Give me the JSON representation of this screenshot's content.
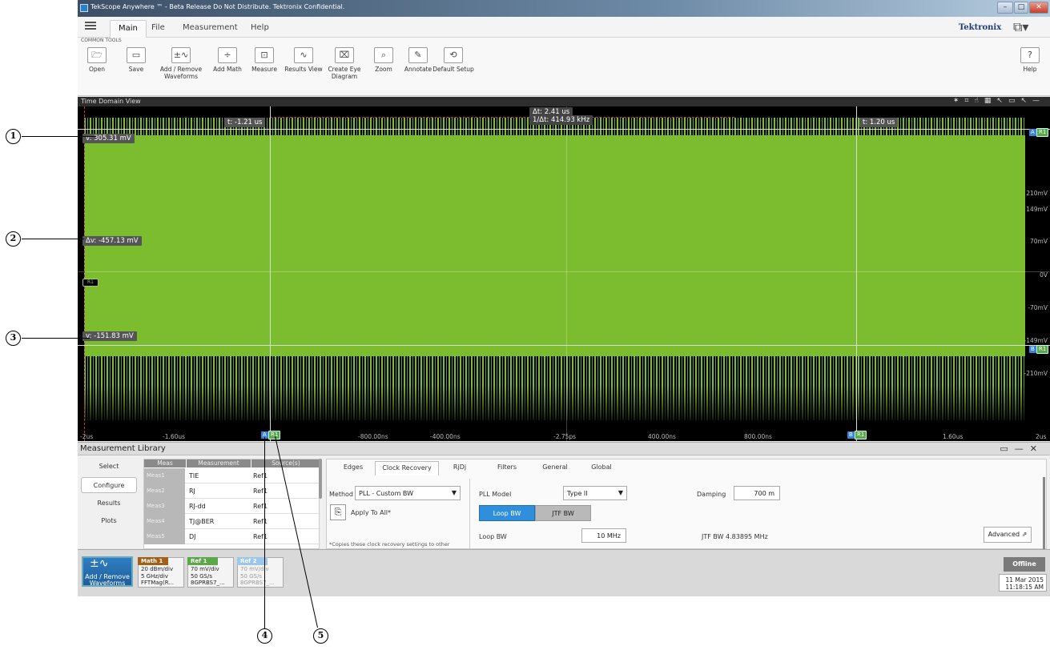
{
  "window": {
    "title": "TekScope Anywhere ™ - Beta Release Do Not Distribute. Tektronix Confidential."
  },
  "menu": {
    "main": "Main",
    "file": "File",
    "measurement": "Measurement",
    "help": "Help",
    "brand": "Tektronix"
  },
  "toolbar": {
    "group_label": "COMMON TOOLS",
    "tools": [
      {
        "label": "Open",
        "icon": "folder-icon"
      },
      {
        "label": "Save",
        "icon": "save-icon"
      },
      {
        "label": "Add / Remove Waveforms",
        "icon": "waveform-icon"
      },
      {
        "label": "Add Math",
        "icon": "math-icon"
      },
      {
        "label": "Measure",
        "icon": "measure-icon"
      },
      {
        "label": "Results View",
        "icon": "results-icon"
      },
      {
        "label": "Create Eye Diagram",
        "icon": "eye-diagram-icon"
      },
      {
        "label": "Zoom",
        "icon": "zoom-icon"
      },
      {
        "label": "Annotate",
        "icon": "annotate-icon"
      },
      {
        "label": "Default Setup",
        "icon": "default-setup-icon"
      }
    ],
    "help": "Help"
  },
  "time_domain": {
    "title": "Time Domain View",
    "readouts": {
      "cursor_a_time": "t: -1.21 us",
      "cursor_b_time": "t: 1.20 us",
      "delta_t": "Δt: 2.41 us",
      "inv_delta_t": "1/Δt: 414.93 kHz",
      "v_top": "v: 305.31 mV",
      "delta_v": "Δv: -457.13 mV",
      "v_bottom": "v: -151.83 mV"
    },
    "y_labels": [
      "210mV",
      "149mV",
      "70mV",
      "0V",
      "-70mV",
      "-149mV",
      "-210mV"
    ],
    "x_labels": [
      "-2us",
      "-1.60us",
      "-800.00ns",
      "-400.00ns",
      "-2.75ps",
      "400.00ns",
      "800.00ns",
      "1.60us",
      "2us"
    ],
    "badges": {
      "a": "A",
      "b": "B",
      "r1": "R1"
    }
  },
  "measurement_library": {
    "title": "Measurement Library",
    "side_tabs": [
      "Select",
      "Configure",
      "Results",
      "Plots"
    ],
    "table": {
      "headers": [
        "Meas",
        "Measurement",
        "Source(s)"
      ],
      "rows": [
        [
          "Meas1",
          "TIE",
          "Ref1"
        ],
        [
          "Meas2",
          "RJ",
          "Ref1"
        ],
        [
          "Meas3",
          "RJ-dd",
          "Ref1"
        ],
        [
          "Meas4",
          "TJ@BER",
          "Ref1"
        ],
        [
          "Meas5",
          "DJ",
          "Ref1"
        ]
      ]
    },
    "config_tabs": [
      "Edges",
      "Clock Recovery",
      "RjDj",
      "Filters",
      "General",
      "Global"
    ],
    "method_label": "Method",
    "method_value": "PLL - Custom BW",
    "apply_all": "Apply To All*",
    "footnote": "*Copies these clock recovery settings to other",
    "pll_model_label": "PLL Model",
    "pll_model_value": "Type II",
    "damping_label": "Damping",
    "damping_value": "700 m",
    "loop_bw_btn": "Loop BW",
    "jtf_bw_btn": "JTF BW",
    "loop_bw_label": "Loop BW",
    "loop_bw_value": "10 MHz",
    "jtf_bw_readout": "JTF BW  4.83895 MHz",
    "advanced": "Advanced"
  },
  "status_bar": {
    "add_remove": "Add / Remove Waveforms",
    "math1": {
      "title": "Math 1",
      "lines": [
        "20 dBm/div",
        "5 GHz/div",
        "FFTMag(R..."
      ]
    },
    "ref1": {
      "title": "Ref 1",
      "lines": [
        "70 mV/div",
        "50 GS/s",
        "8GPRBS7_..."
      ]
    },
    "ref2": {
      "title": "Ref 2",
      "lines": [
        "70 mV/div",
        "50 GS/s",
        "8GPRBS7_..."
      ]
    },
    "offline": "Offline",
    "date": "11 Mar 2015",
    "time": "11:18:15 AM"
  },
  "callouts": [
    "1",
    "2",
    "3",
    "4",
    "5"
  ],
  "colors": {
    "waveform": "#7cbd2f",
    "math": "#a0601a",
    "ref1": "#5aa84a",
    "ref2": "#9cc7e8",
    "accent": "#2f8fdc"
  }
}
